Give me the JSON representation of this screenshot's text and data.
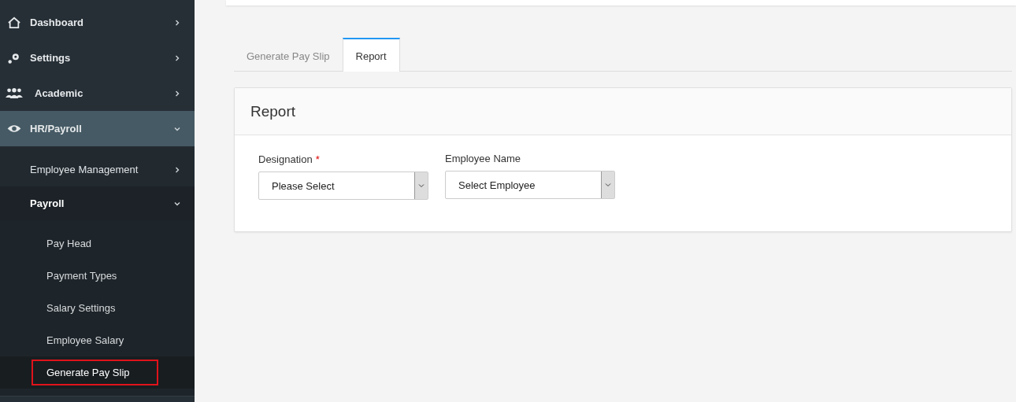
{
  "sidebar": {
    "items": [
      {
        "label": "Dashboard",
        "expanded": false,
        "selected": false
      },
      {
        "label": "Settings",
        "expanded": false,
        "selected": false
      },
      {
        "label": "Academic",
        "expanded": false,
        "selected": false
      },
      {
        "label": "HR/Payroll",
        "expanded": true,
        "selected": true,
        "children": [
          {
            "label": "Employee Management",
            "expanded": false
          },
          {
            "label": "Payroll",
            "expanded": true,
            "children": [
              {
                "label": "Pay Head",
                "selected": false
              },
              {
                "label": "Payment Types",
                "selected": false
              },
              {
                "label": "Salary Settings",
                "selected": false
              },
              {
                "label": "Employee Salary",
                "selected": false
              },
              {
                "label": "Generate Pay Slip",
                "selected": true
              }
            ]
          }
        ]
      }
    ]
  },
  "tabs": [
    {
      "label": "Generate Pay Slip",
      "selected": false
    },
    {
      "label": "Report",
      "selected": true
    }
  ],
  "panel": {
    "title": "Report",
    "fields": [
      {
        "label": "Designation",
        "required_mark": "*",
        "value": "Please Select"
      },
      {
        "label": "Employee Name",
        "value": "Select Employee"
      }
    ]
  }
}
